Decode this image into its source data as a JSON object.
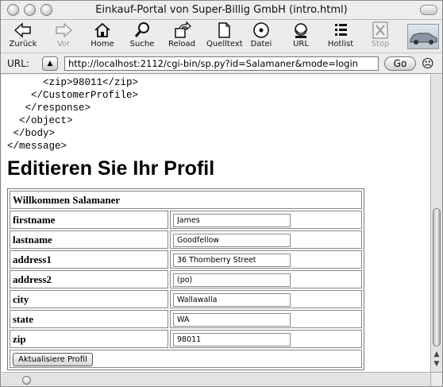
{
  "window": {
    "title": "Einkauf-Portal von Super-Billig GmbH (intro.html)"
  },
  "toolbar": {
    "items": [
      {
        "label": "Zurück",
        "icon": "back-arrow-icon",
        "enabled": true
      },
      {
        "label": "Vor",
        "icon": "forward-arrow-icon",
        "enabled": false
      },
      {
        "label": "Home",
        "icon": "home-icon",
        "enabled": true
      },
      {
        "label": "Suche",
        "icon": "search-icon",
        "enabled": true
      },
      {
        "label": "Reload",
        "icon": "reload-icon",
        "enabled": true
      },
      {
        "label": "Quelltext",
        "icon": "source-icon",
        "enabled": true
      },
      {
        "label": "Datei",
        "icon": "disc-icon",
        "enabled": true
      },
      {
        "label": "URL",
        "icon": "url-icon",
        "enabled": true
      },
      {
        "label": "Hotlist",
        "icon": "hotlist-icon",
        "enabled": true
      },
      {
        "label": "Stop",
        "icon": "stop-icon",
        "enabled": false
      }
    ]
  },
  "urlbar": {
    "label": "URL:",
    "value": "http://localhost:2112/cgi-bin/sp.py?id=Salamaner&mode=login",
    "go_label": "Go"
  },
  "content": {
    "xml_lines": [
      "      <zip>98011</zip>",
      "    </CustomerProfile>",
      "   </response>",
      "  </object>",
      " </body>",
      "</message>"
    ],
    "heading": "Editieren Sie Ihr Profil",
    "form": {
      "welcome": "Willkommen Salamaner",
      "fields": [
        {
          "label": "firstname",
          "value": "James"
        },
        {
          "label": "lastname",
          "value": "Goodfellow"
        },
        {
          "label": "address1",
          "value": "36 Thornberry Street"
        },
        {
          "label": "address2",
          "value": "(po)"
        },
        {
          "label": "city",
          "value": "Wallawalla"
        },
        {
          "label": "state",
          "value": "WA"
        },
        {
          "label": "zip",
          "value": "98011"
        }
      ],
      "submit_label": "Aktualisiere Profil"
    }
  }
}
